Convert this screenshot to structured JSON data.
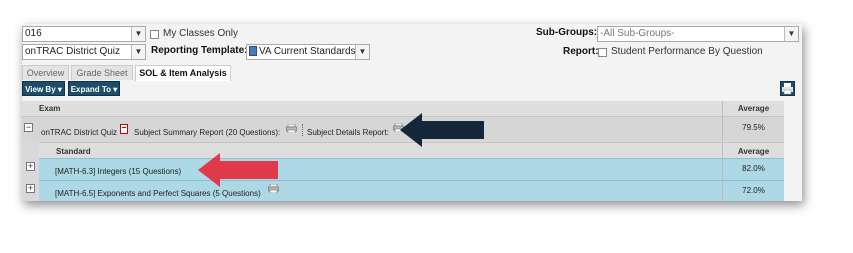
{
  "filters": {
    "year_value": "016",
    "my_classes_label": "My Classes Only",
    "quiz_value": "onTRAC District Quiz",
    "reporting_template_label": "Reporting Template:",
    "reporting_template_value": "VA Current Standards",
    "subgroups_label": "Sub-Groups:",
    "subgroups_value": "-All Sub-Groups-",
    "report_label": "Report:",
    "report_option_label": "Student Performance By Question"
  },
  "tabs": [
    {
      "label": "Overview"
    },
    {
      "label": "Grade Sheet"
    },
    {
      "label": "SOL & Item Analysis"
    }
  ],
  "toolbar": {
    "view_by_label": "View By ▾",
    "expand_to_label": "Expand To ▾"
  },
  "table": {
    "exam_header": "Exam",
    "average_header": "Average",
    "exam_row": {
      "name": "onTRAC District Quiz",
      "summary_link": "Subject Summary Report (20 Questions):",
      "details_link": "Subject Details Report:",
      "average": "79.5%"
    },
    "standard_header": "Standard",
    "standard_average_header": "Average",
    "standards": [
      {
        "label": "[MATH-6.3] Integers (15 Questions)",
        "average": "82.0%"
      },
      {
        "label": "[MATH-6.5] Exponents and Perfect Squares (5 Questions)",
        "average": "72.0%"
      }
    ]
  },
  "colors": {
    "accent_button": "#1c4e6b",
    "standard_row_bg": "#add8e6",
    "red_arrow": "#e03a4a",
    "dark_arrow": "#14283a"
  }
}
